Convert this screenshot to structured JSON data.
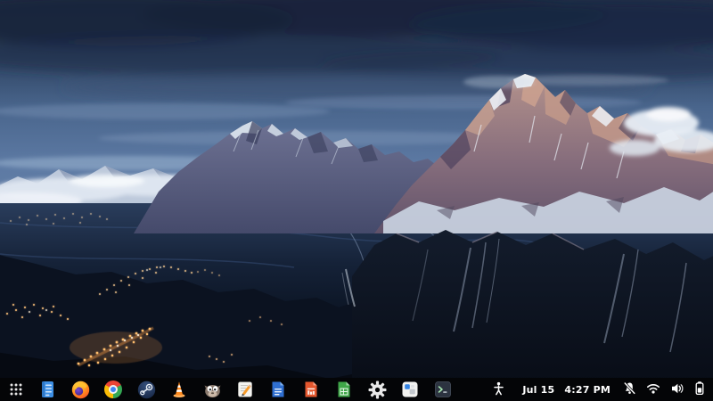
{
  "wallpaper": {
    "scene": "snow-covered alpine peaks at dusk with dark cloudy sky and a valley village glowing with warm lights"
  },
  "taskbar": {
    "colors": {
      "background": "#040507",
      "clock_text": "#ffffff"
    },
    "launcher": {
      "icon": "apps-grid-icon",
      "title": "show-applications"
    },
    "apps": [
      {
        "id": "files",
        "icon": "files-icon"
      },
      {
        "id": "firefox",
        "icon": "firefox-icon"
      },
      {
        "id": "chrome",
        "icon": "chrome-icon"
      },
      {
        "id": "steam",
        "icon": "steam-icon"
      },
      {
        "id": "vlc",
        "icon": "vlc-cone-icon"
      },
      {
        "id": "gimp",
        "icon": "gimp-wilber-icon"
      },
      {
        "id": "text-editor",
        "icon": "text-editor-pencil-icon"
      },
      {
        "id": "libreoffice-writer",
        "icon": "writer-document-icon"
      },
      {
        "id": "libreoffice-impress",
        "icon": "impress-document-icon"
      },
      {
        "id": "libreoffice-calc",
        "icon": "calc-document-icon"
      },
      {
        "id": "settings",
        "icon": "gear-icon"
      },
      {
        "id": "software-store",
        "icon": "software-icon"
      },
      {
        "id": "terminal",
        "icon": "terminal-icon"
      }
    ],
    "status": {
      "accessibility_icon": "accessibility-icon",
      "date": "Jul 15",
      "time": "4:27 PM",
      "notifications_icon": "bell-slash-icon",
      "wifi_icon": "wifi-icon",
      "volume_icon": "volume-icon",
      "battery_icon": "battery-icon"
    }
  }
}
